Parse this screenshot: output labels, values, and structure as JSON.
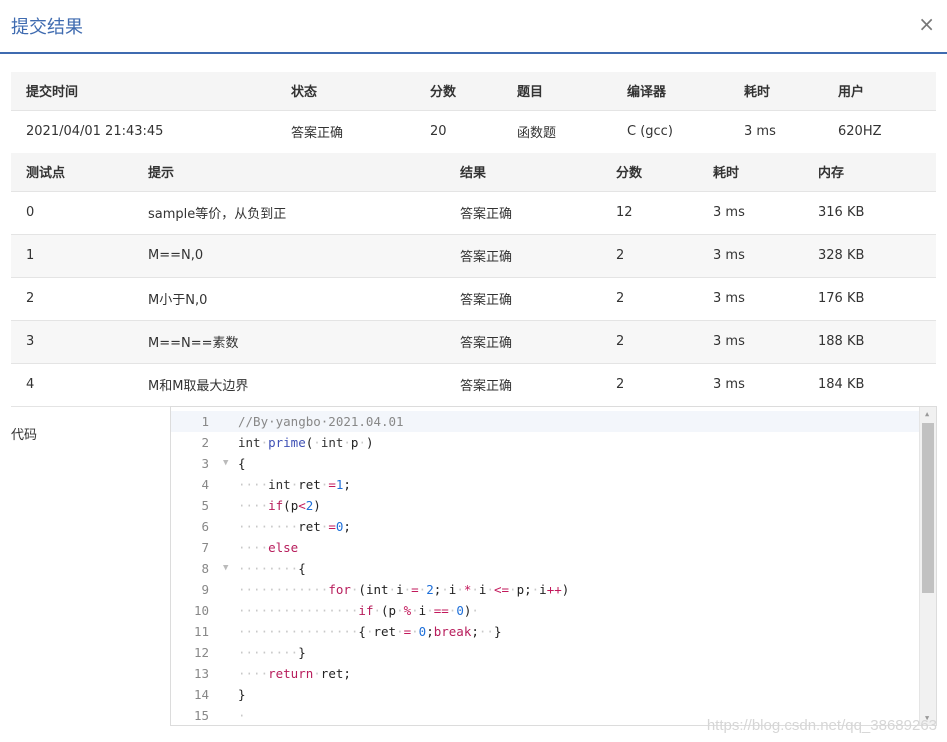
{
  "dialog": {
    "title": "提交结果",
    "close_glyph": "×"
  },
  "summary": {
    "headers": [
      "提交时间",
      "状态",
      "分数",
      "题目",
      "编译器",
      "耗时",
      "用户"
    ],
    "row": [
      "2021/04/01 21:43:45",
      "答案正确",
      "20",
      "函数题",
      "C (gcc)",
      "3 ms",
      "620HZ"
    ]
  },
  "cases": {
    "headers": [
      "测试点",
      "提示",
      "结果",
      "分数",
      "耗时",
      "内存"
    ],
    "rows": [
      [
        "0",
        "sample等价，从负到正",
        "答案正确",
        "12",
        "3 ms",
        "316 KB"
      ],
      [
        "1",
        "M==N,0",
        "答案正确",
        "2",
        "3 ms",
        "328 KB"
      ],
      [
        "2",
        "M小于N,0",
        "答案正确",
        "2",
        "3 ms",
        "176 KB"
      ],
      [
        "3",
        "M==N==素数",
        "答案正确",
        "2",
        "3 ms",
        "188 KB"
      ],
      [
        "4",
        "M和M取最大边界",
        "答案正确",
        "2",
        "3 ms",
        "184 KB"
      ]
    ]
  },
  "code": {
    "label": "代码",
    "line_numbers": [
      "1",
      "2",
      "3",
      "4",
      "5",
      "6",
      "7",
      "8",
      "9",
      "10",
      "11",
      "12",
      "13",
      "14",
      "15"
    ],
    "fold_markers": [
      "",
      "",
      "▼",
      "",
      "",
      "",
      "",
      "▼",
      "",
      "",
      "",
      "",
      "",
      "",
      ""
    ],
    "lines": [
      [
        [
          "c",
          "//By·yangbo·2021.04.01"
        ]
      ],
      [
        [
          "t",
          "int"
        ],
        [
          "w",
          "·"
        ],
        [
          "f",
          "prime"
        ],
        [
          "p",
          "("
        ],
        [
          "w",
          "·"
        ],
        [
          "t",
          "int"
        ],
        [
          "w",
          "·"
        ],
        [
          "p",
          "p"
        ],
        [
          "w",
          "·"
        ],
        [
          "p",
          ")"
        ]
      ],
      [
        [
          "p",
          "{"
        ]
      ],
      [
        [
          "w",
          "····"
        ],
        [
          "t",
          "int"
        ],
        [
          "w",
          "·"
        ],
        [
          "p",
          "ret"
        ],
        [
          "w",
          "·"
        ],
        [
          "o",
          "="
        ],
        [
          "n",
          "1"
        ],
        [
          "p",
          ";"
        ]
      ],
      [
        [
          "w",
          "····"
        ],
        [
          "k",
          "if"
        ],
        [
          "p",
          "(p"
        ],
        [
          "o",
          "<"
        ],
        [
          "n",
          "2"
        ],
        [
          "p",
          ")"
        ]
      ],
      [
        [
          "w",
          "········"
        ],
        [
          "p",
          "ret"
        ],
        [
          "w",
          "·"
        ],
        [
          "o",
          "="
        ],
        [
          "n",
          "0"
        ],
        [
          "p",
          ";"
        ]
      ],
      [
        [
          "w",
          "····"
        ],
        [
          "k",
          "else"
        ]
      ],
      [
        [
          "w",
          "········"
        ],
        [
          "p",
          "{"
        ]
      ],
      [
        [
          "w",
          "············"
        ],
        [
          "k",
          "for"
        ],
        [
          "w",
          "·"
        ],
        [
          "p",
          "(int"
        ],
        [
          "w",
          "·"
        ],
        [
          "p",
          "i"
        ],
        [
          "w",
          "·"
        ],
        [
          "o",
          "="
        ],
        [
          "w",
          "·"
        ],
        [
          "n",
          "2"
        ],
        [
          "p",
          ";"
        ],
        [
          "w",
          "·"
        ],
        [
          "p",
          "i"
        ],
        [
          "w",
          "·"
        ],
        [
          "o",
          "*"
        ],
        [
          "w",
          "·"
        ],
        [
          "p",
          "i"
        ],
        [
          "w",
          "·"
        ],
        [
          "o",
          "<="
        ],
        [
          "w",
          "·"
        ],
        [
          "p",
          "p;"
        ],
        [
          "w",
          "·"
        ],
        [
          "p",
          "i"
        ],
        [
          "o",
          "++"
        ],
        [
          "p",
          ")"
        ]
      ],
      [
        [
          "w",
          "················"
        ],
        [
          "k",
          "if"
        ],
        [
          "w",
          "·"
        ],
        [
          "p",
          "(p"
        ],
        [
          "w",
          "·"
        ],
        [
          "o",
          "%"
        ],
        [
          "w",
          "·"
        ],
        [
          "p",
          "i"
        ],
        [
          "w",
          "·"
        ],
        [
          "o",
          "=="
        ],
        [
          "w",
          "·"
        ],
        [
          "n",
          "0"
        ],
        [
          "p",
          ")"
        ],
        [
          "w",
          "·"
        ]
      ],
      [
        [
          "w",
          "················"
        ],
        [
          "p",
          "{"
        ],
        [
          "w",
          "·"
        ],
        [
          "p",
          "ret"
        ],
        [
          "w",
          "·"
        ],
        [
          "o",
          "="
        ],
        [
          "w",
          "·"
        ],
        [
          "n",
          "0"
        ],
        [
          "p",
          ";"
        ],
        [
          "k",
          "break"
        ],
        [
          "p",
          ";"
        ],
        [
          "w",
          "··"
        ],
        [
          "p",
          "}"
        ]
      ],
      [
        [
          "w",
          "········"
        ],
        [
          "p",
          "}"
        ]
      ],
      [
        [
          "w",
          "····"
        ],
        [
          "k",
          "return"
        ],
        [
          "w",
          "·"
        ],
        [
          "p",
          "ret;"
        ]
      ],
      [
        [
          "p",
          "}"
        ]
      ],
      [
        [
          "w",
          "·"
        ]
      ]
    ]
  },
  "watermark": "https://blog.csdn.net/qq_38689263"
}
